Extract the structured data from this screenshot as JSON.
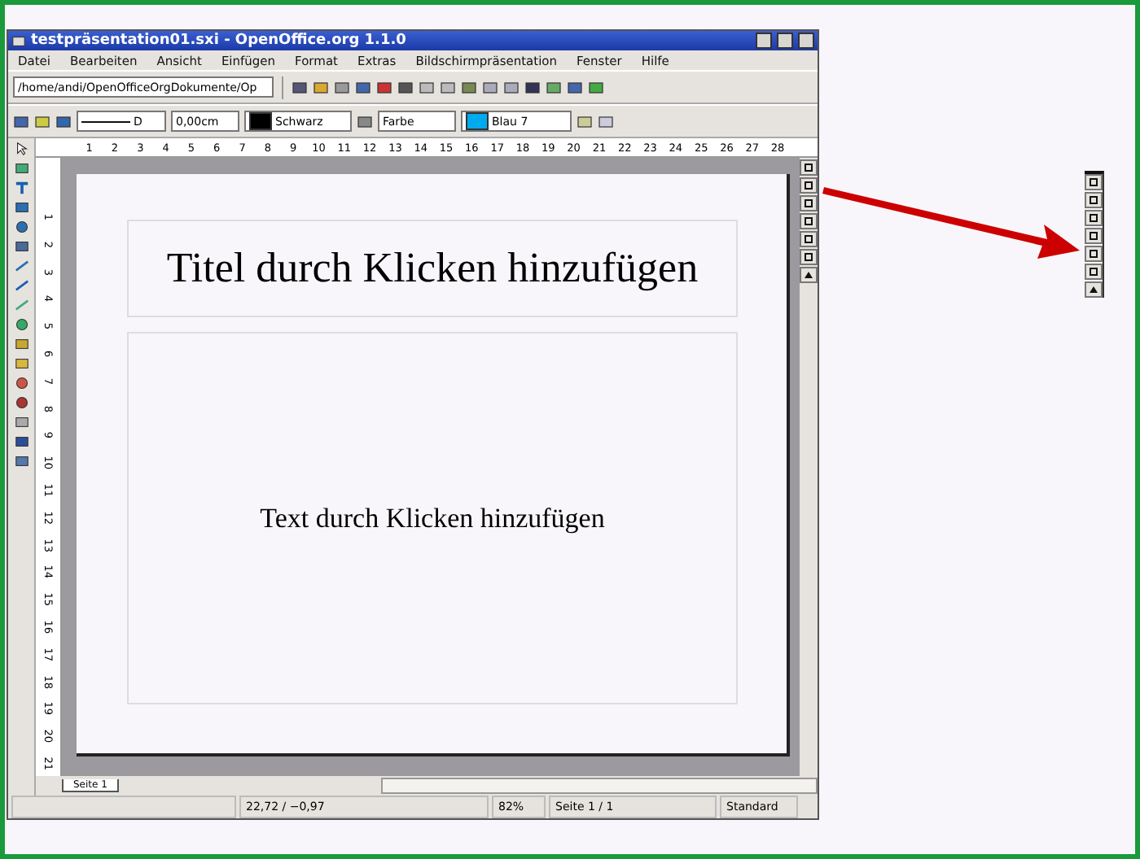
{
  "window": {
    "title": "testpräsentation01.sxi - OpenOffice.org 1.1.0"
  },
  "menu": [
    "Datei",
    "Bearbeiten",
    "Ansicht",
    "Einfügen",
    "Format",
    "Extras",
    "Bildschirmpräsentation",
    "Fenster",
    "Hilfe"
  ],
  "toolbar": {
    "path": "/home/andi/OpenOfficeOrgDokumente/Op"
  },
  "object_bar": {
    "line_style": "D",
    "line_width": "0,00cm",
    "line_color": "Schwarz",
    "area_style": "Farbe",
    "area_color": "Blau 7"
  },
  "ruler_h": [
    "1",
    "2",
    "3",
    "4",
    "5",
    "6",
    "7",
    "8",
    "9",
    "10",
    "11",
    "12",
    "13",
    "14",
    "15",
    "16",
    "17",
    "18",
    "19",
    "20",
    "21",
    "22",
    "23",
    "24",
    "25",
    "26",
    "27",
    "28"
  ],
  "ruler_v": [
    "1",
    "2",
    "3",
    "4",
    "5",
    "6",
    "7",
    "8",
    "9",
    "10",
    "11",
    "12",
    "13",
    "14",
    "15",
    "16",
    "17",
    "18",
    "19",
    "20",
    "21"
  ],
  "slide": {
    "title": "Titel durch Klicken hinzufügen",
    "body": "Text durch Klicken hinzufügen"
  },
  "tabs": [
    {
      "label": "Seite 1",
      "selected": true
    }
  ],
  "status_bar": {
    "position": "22,72 / −0,97",
    "zoom": "82%",
    "page": "Seite 1 / 1",
    "layout": "Standard"
  }
}
